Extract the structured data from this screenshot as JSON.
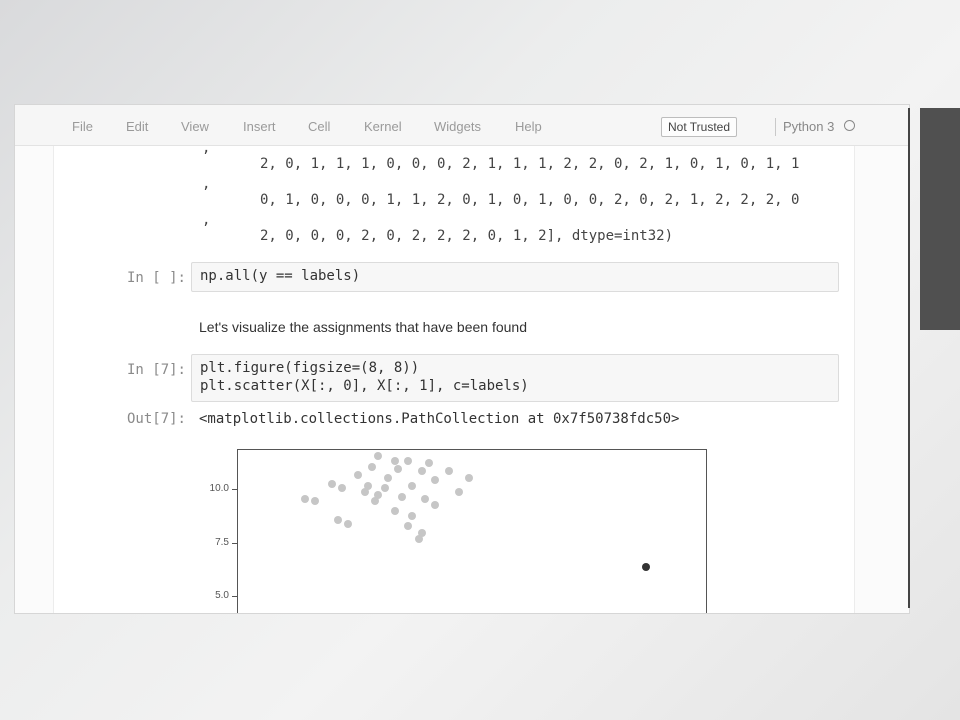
{
  "menubar": {
    "items": [
      "File",
      "Edit",
      "View",
      "Insert",
      "Cell",
      "Kernel",
      "Widgets",
      "Help"
    ],
    "trust_label": "Not Trusted",
    "kernel_name": "Python 3"
  },
  "array_output": {
    "lines": [
      "2, 0, 1, 1, 1, 0, 0, 0, 2, 1, 1, 1, 2, 2, 0, 2, 1, 0, 1, 0, 1, 1",
      "0, 1, 0, 0, 0, 1, 1, 2, 0, 1, 0, 1, 0, 0, 2, 0, 2, 1, 2, 2, 2, 0",
      "2, 0, 0, 0, 2, 0, 2, 2, 2, 0, 1, 2], dtype=int32)"
    ],
    "comma": ","
  },
  "cells": [
    {
      "prompt": "In [ ]:",
      "code": [
        "np.all(y == labels)"
      ]
    },
    {
      "markdown": "Let's visualize the assignments that have been found"
    },
    {
      "prompt": "In [7]:",
      "code": [
        "plt.figure(figsize=(8, 8))",
        "plt.scatter(X[:, 0], X[:, 1], c=labels)"
      ]
    }
  ],
  "output": {
    "prompt": "Out[7]:",
    "text": "<matplotlib.collections.PathCollection at 0x7f50738fdc50>"
  },
  "chart_data": {
    "type": "scatter",
    "yticks": [
      "10.0",
      "7.5",
      "5.0"
    ],
    "ylim": [
      4.6,
      11.3
    ],
    "points": [
      {
        "x": 0.1,
        "y": 11.0
      },
      {
        "x": 0.35,
        "y": 10.8
      },
      {
        "x": 0.55,
        "y": 10.8
      },
      {
        "x": 0.85,
        "y": 10.7
      },
      {
        "x": 0.0,
        "y": 10.5
      },
      {
        "x": 0.4,
        "y": 10.4
      },
      {
        "x": 0.75,
        "y": 10.3
      },
      {
        "x": 1.15,
        "y": 10.3
      },
      {
        "x": 1.45,
        "y": 10.0
      },
      {
        "x": -0.2,
        "y": 10.1
      },
      {
        "x": 0.25,
        "y": 10.0
      },
      {
        "x": 0.95,
        "y": 9.9
      },
      {
        "x": -0.6,
        "y": 9.7
      },
      {
        "x": -0.45,
        "y": 9.5
      },
      {
        "x": -0.05,
        "y": 9.6
      },
      {
        "x": 0.2,
        "y": 9.5
      },
      {
        "x": 0.6,
        "y": 9.6
      },
      {
        "x": 1.3,
        "y": 9.3
      },
      {
        "x": -0.1,
        "y": 9.3
      },
      {
        "x": 0.1,
        "y": 9.2
      },
      {
        "x": 0.45,
        "y": 9.1
      },
      {
        "x": -1.0,
        "y": 9.0
      },
      {
        "x": -0.85,
        "y": 8.9
      },
      {
        "x": 0.05,
        "y": 8.9
      },
      {
        "x": 0.8,
        "y": 9.0
      },
      {
        "x": 0.95,
        "y": 8.7
      },
      {
        "x": 0.35,
        "y": 8.4
      },
      {
        "x": 0.6,
        "y": 8.2
      },
      {
        "x": -0.5,
        "y": 8.0
      },
      {
        "x": -0.35,
        "y": 7.8
      },
      {
        "x": 0.55,
        "y": 7.7
      },
      {
        "x": 0.75,
        "y": 7.4
      },
      {
        "x": 0.7,
        "y": 7.1
      },
      {
        "x": 4.1,
        "y": 5.8
      }
    ],
    "highlight_index": 33
  }
}
